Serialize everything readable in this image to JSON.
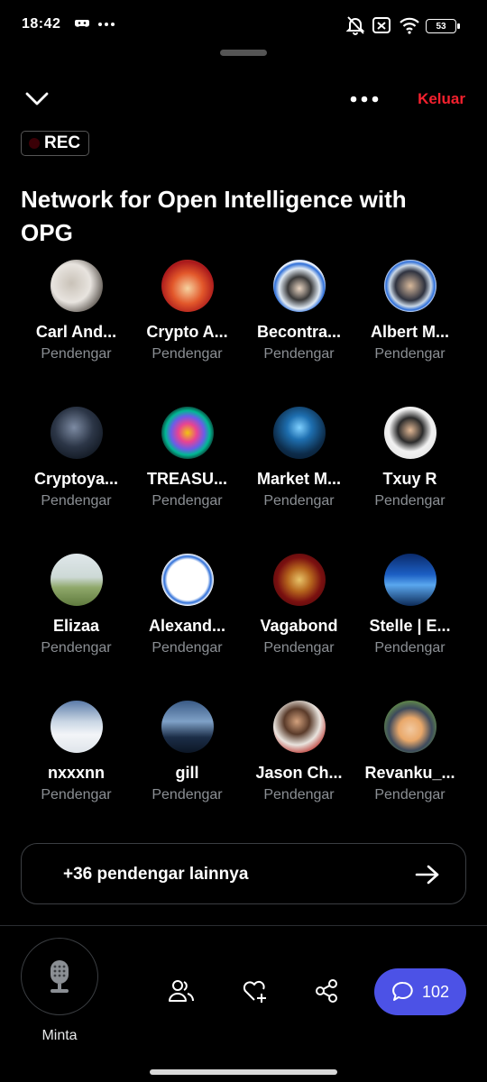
{
  "status_bar": {
    "time": "18:42",
    "battery": "53"
  },
  "header": {
    "leave_label": "Keluar",
    "rec_label": "REC",
    "title": "Network for Open Intelligence with OPG"
  },
  "participants": [
    {
      "name": "Carl And...",
      "role": "Pendengar"
    },
    {
      "name": "Crypto A...",
      "role": "Pendengar"
    },
    {
      "name": "Becontra...",
      "role": "Pendengar"
    },
    {
      "name": "Albert M...",
      "role": "Pendengar"
    },
    {
      "name": "Cryptoya...",
      "role": "Pendengar"
    },
    {
      "name": "TREASU...",
      "role": "Pendengar"
    },
    {
      "name": "Market M...",
      "role": "Pendengar"
    },
    {
      "name": "Txuy R",
      "role": "Pendengar"
    },
    {
      "name": "Elizaa",
      "role": "Pendengar"
    },
    {
      "name": "Alexand...",
      "role": "Pendengar"
    },
    {
      "name": "Vagabond",
      "role": "Pendengar"
    },
    {
      "name": "Stelle | E...",
      "role": "Pendengar"
    },
    {
      "name": "nxxxnn",
      "role": "Pendengar"
    },
    {
      "name": "gill",
      "role": "Pendengar"
    },
    {
      "name": "Jason Ch...",
      "role": "Pendengar"
    },
    {
      "name": "Revanku_...",
      "role": "Pendengar"
    }
  ],
  "more_listeners_label": "+36 pendengar lainnya",
  "bottom_bar": {
    "request_label": "Minta",
    "comments_count": "102"
  },
  "colors": {
    "accent": "#4c52e6",
    "leave": "#f4212e"
  }
}
